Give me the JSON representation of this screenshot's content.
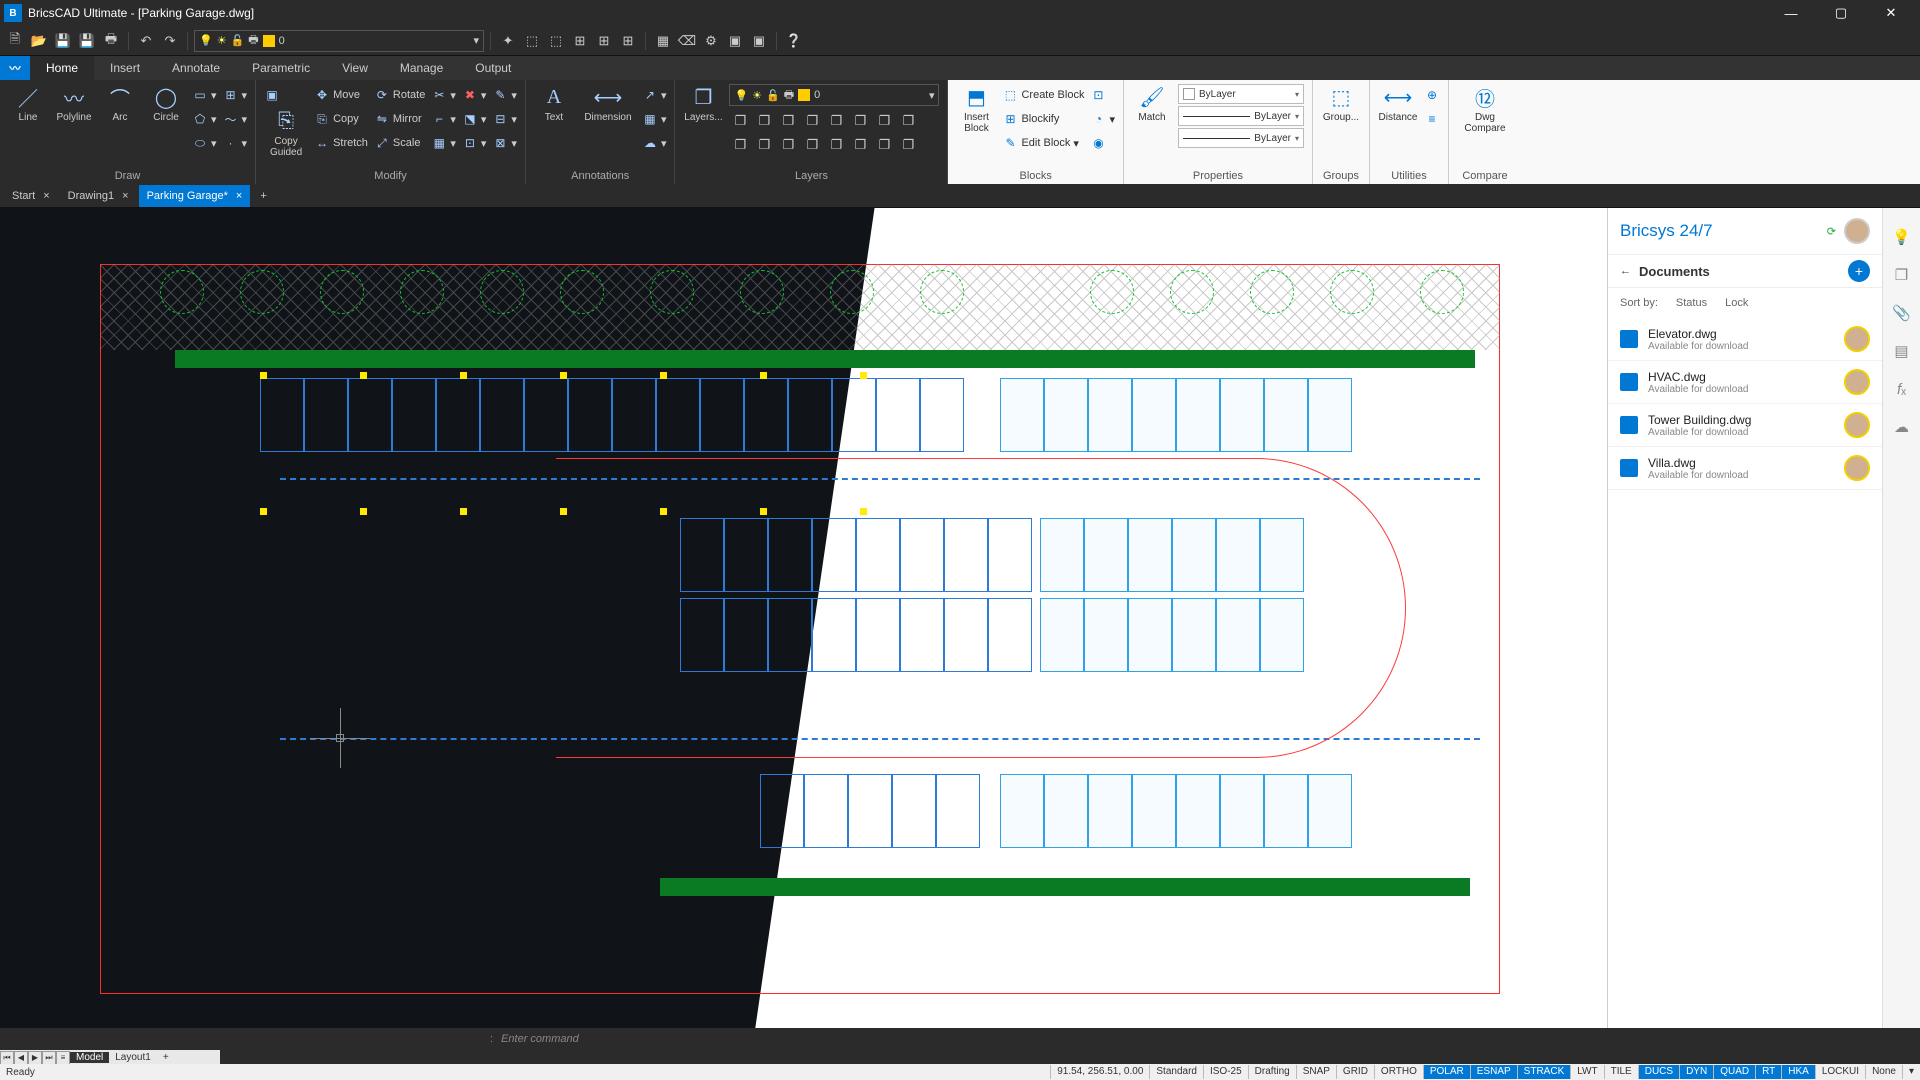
{
  "app": {
    "title": "BricsCAD Ultimate - [Parking Garage.dwg]"
  },
  "win": {
    "min": "—",
    "max": "▢",
    "close": "✕"
  },
  "qat_layer_value": "0",
  "ribbon_tabs": [
    "Home",
    "Insert",
    "Annotate",
    "Parametric",
    "View",
    "Manage",
    "Output"
  ],
  "ribbon": {
    "draw": {
      "label": "Draw",
      "line": "Line",
      "polyline": "Polyline",
      "arc": "Arc",
      "circle": "Circle"
    },
    "modify": {
      "label": "Modify",
      "copy_guided": "Copy Guided",
      "move": "Move",
      "copy": "Copy",
      "stretch": "Stretch",
      "rotate": "Rotate",
      "mirror": "Mirror",
      "scale": "Scale"
    },
    "annotations": {
      "label": "Annotations",
      "text": "Text",
      "dimension": "Dimension"
    },
    "layers": {
      "label": "Layers",
      "layers": "Layers...",
      "combo_value": "0"
    },
    "blocks": {
      "label": "Blocks",
      "insert": "Insert Block",
      "create": "Create Block",
      "blockify": "Blockify",
      "edit": "Edit Block"
    },
    "properties": {
      "label": "Properties",
      "match": "Match",
      "bylayer": "ByLayer"
    },
    "groups": {
      "label": "Groups",
      "group": "Group..."
    },
    "utilities": {
      "label": "Utilities",
      "distance": "Distance"
    },
    "compare": {
      "label": "Compare",
      "dwg": "Dwg Compare"
    }
  },
  "doctabs": {
    "start": "Start",
    "d1": "Drawing1",
    "d2": "Parking Garage*"
  },
  "panel": {
    "title": "Bricsys 24/7",
    "section": "Documents",
    "sort_label": "Sort by:",
    "sort_status": "Status",
    "sort_lock": "Lock",
    "docs": [
      {
        "name": "Elevator.dwg",
        "status": "Available for download"
      },
      {
        "name": "HVAC.dwg",
        "status": "Available for download"
      },
      {
        "name": "Tower Building.dwg",
        "status": "Available for download"
      },
      {
        "name": "Villa.dwg",
        "status": "Available for download"
      }
    ]
  },
  "cmd": {
    "placeholder": "Enter command",
    "prefix": ": "
  },
  "layout": {
    "model": "Model",
    "layout1": "Layout1"
  },
  "status": {
    "ready": "Ready",
    "coords": "91.54, 256.51, 0.00",
    "standard": "Standard",
    "iso": "ISO-25",
    "drafting": "Drafting",
    "toggles": [
      "SNAP",
      "GRID",
      "ORTHO",
      "POLAR",
      "ESNAP",
      "STRACK",
      "LWT",
      "TILE",
      "DUCS",
      "DYN",
      "QUAD",
      "RT",
      "HKA",
      "LOCKUI",
      "None"
    ],
    "toggles_on": [
      3,
      4,
      5,
      8,
      9,
      10,
      11,
      12
    ],
    "arrow": "▾"
  }
}
